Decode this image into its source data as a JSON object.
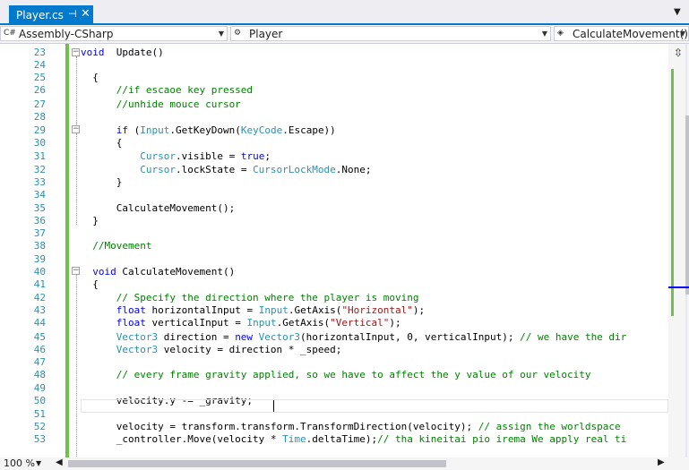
{
  "tab": {
    "title": "Player.cs",
    "pin_glyph": "⊣",
    "close_glyph": "✕"
  },
  "tab_dropdown_glyph": "▼",
  "navbar": {
    "project": "Assembly-CSharp",
    "class": "Player",
    "member": "CalculateMovement()",
    "project_icon": "C#",
    "arrow": "▼"
  },
  "status": {
    "zoom": "100 %"
  },
  "code_lines": [
    {
      "n": "23",
      "tokens": [
        [
          "kw",
          "void"
        ],
        [
          "",
          "  Update()"
        ]
      ]
    },
    {
      "n": "24",
      "tokens": []
    },
    {
      "n": "25",
      "tokens": [
        [
          "",
          "  {"
        ]
      ]
    },
    {
      "n": "26",
      "tokens": [
        [
          "cm",
          "      //if escaoe key pressed"
        ]
      ]
    },
    {
      "n": "27",
      "tokens": [
        [
          "cm",
          "      //unhide mouce cursor"
        ]
      ]
    },
    {
      "n": "28",
      "tokens": []
    },
    {
      "n": "29",
      "tokens": [
        [
          "kw",
          "      if"
        ],
        [
          "",
          " ("
        ],
        [
          "ty",
          "Input"
        ],
        [
          "",
          ".GetKeyDown("
        ],
        [
          "ty",
          "KeyCode"
        ],
        [
          "",
          ".Escape))"
        ]
      ]
    },
    {
      "n": "30",
      "tokens": [
        [
          "",
          "      {"
        ]
      ]
    },
    {
      "n": "31",
      "tokens": [
        [
          "ty",
          "          Cursor"
        ],
        [
          "",
          ".visible = "
        ],
        [
          "kw",
          "true"
        ],
        [
          "",
          ";"
        ]
      ]
    },
    {
      "n": "32",
      "tokens": [
        [
          "ty",
          "          Cursor"
        ],
        [
          "",
          ".lockState = "
        ],
        [
          "ty",
          "CursorLockMode"
        ],
        [
          "",
          ".None;"
        ]
      ]
    },
    {
      "n": "33",
      "tokens": [
        [
          "",
          "      }"
        ]
      ]
    },
    {
      "n": "34",
      "tokens": []
    },
    {
      "n": "35",
      "tokens": [
        [
          "",
          "      CalculateMovement();"
        ]
      ]
    },
    {
      "n": "36",
      "tokens": [
        [
          "",
          "  }"
        ]
      ]
    },
    {
      "n": "37",
      "tokens": []
    },
    {
      "n": "38",
      "tokens": [
        [
          "cm",
          "  //Movement"
        ]
      ]
    },
    {
      "n": "39",
      "tokens": []
    },
    {
      "n": "40",
      "tokens": [
        [
          "kw",
          "  void"
        ],
        [
          "",
          " CalculateMovement()"
        ]
      ]
    },
    {
      "n": "41",
      "tokens": [
        [
          "",
          "  {"
        ]
      ]
    },
    {
      "n": "42",
      "tokens": [
        [
          "cm",
          "      // Specify the direction where the player is moving"
        ]
      ]
    },
    {
      "n": "43",
      "tokens": [
        [
          "kw",
          "      float"
        ],
        [
          "",
          " horizontalInput = "
        ],
        [
          "ty",
          "Input"
        ],
        [
          "",
          ".GetAxis("
        ],
        [
          "st",
          "\"Horizontal\""
        ],
        [
          "",
          ");"
        ]
      ]
    },
    {
      "n": "44",
      "tokens": [
        [
          "kw",
          "      float"
        ],
        [
          "",
          " verticalInput = "
        ],
        [
          "ty",
          "Input"
        ],
        [
          "",
          ".GetAxis("
        ],
        [
          "st",
          "\"Vertical\""
        ],
        [
          "",
          ");"
        ]
      ]
    },
    {
      "n": "45",
      "tokens": [
        [
          "ty",
          "      Vector3"
        ],
        [
          "",
          " direction = "
        ],
        [
          "kw",
          "new"
        ],
        [
          "",
          ""
        ],
        [
          "ty",
          " Vector3"
        ],
        [
          "",
          "(horizontalInput, 0, verticalInput); "
        ],
        [
          "cm",
          "// we have the dir"
        ]
      ]
    },
    {
      "n": "46",
      "tokens": [
        [
          "ty",
          "      Vector3"
        ],
        [
          "",
          " velocity = direction * _speed;"
        ]
      ]
    },
    {
      "n": "47",
      "tokens": []
    },
    {
      "n": "48",
      "tokens": [
        [
          "cm",
          "      // every frame gravity applied, so we have to affect the y value of our velocity"
        ]
      ]
    },
    {
      "n": "49",
      "tokens": []
    },
    {
      "n": "50",
      "tokens": [
        [
          "",
          "      velocity.y -= _gravity;"
        ]
      ]
    },
    {
      "n": "51",
      "tokens": []
    },
    {
      "n": "52",
      "tokens": [
        [
          "",
          "      velocity = transform.transform.TransformDirection(velocity); "
        ],
        [
          "cm",
          "// assign the worldspace"
        ]
      ]
    },
    {
      "n": "53",
      "tokens": [
        [
          "",
          "      _controller.Move(velocity * "
        ],
        [
          "ty",
          "Time"
        ],
        [
          "",
          ".deltaTime);"
        ],
        [
          "cm",
          "// tha kineitai pio irema We apply real ti"
        ]
      ]
    }
  ]
}
